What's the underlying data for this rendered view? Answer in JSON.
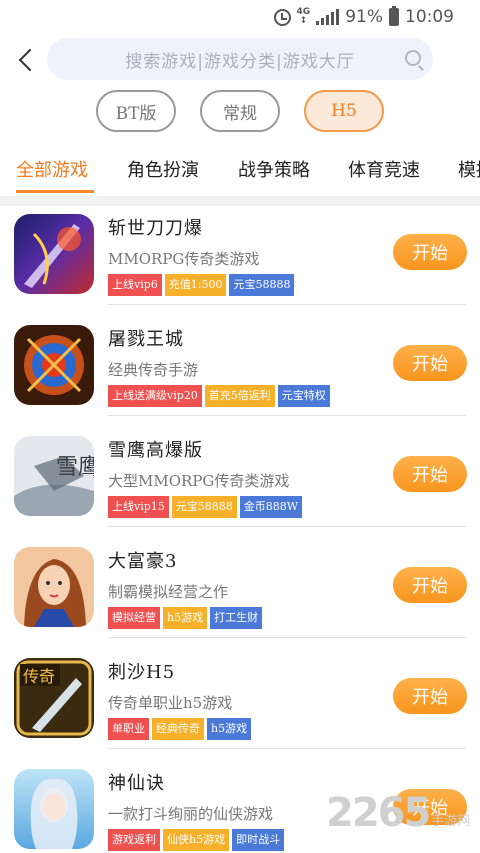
{
  "status_bar": {
    "network": "4G",
    "battery": "91%",
    "time": "10:09"
  },
  "header": {
    "search_placeholder": "搜索游戏|游戏分类|游戏大厅"
  },
  "versions": [
    {
      "label": "BT版",
      "active": false
    },
    {
      "label": "常规",
      "active": false
    },
    {
      "label": "H5",
      "active": true
    }
  ],
  "tabs": [
    {
      "label": "全部游戏",
      "active": true
    },
    {
      "label": "角色扮演",
      "active": false
    },
    {
      "label": "战争策略",
      "active": false
    },
    {
      "label": "体育竞速",
      "active": false
    },
    {
      "label": "模拟",
      "active": false
    }
  ],
  "games": [
    {
      "name": "斩世刀刀爆",
      "desc": "MMORPG传奇类游戏",
      "tags": [
        {
          "text": "上线vip6",
          "color": "red"
        },
        {
          "text": "充值1:500",
          "color": "orange"
        },
        {
          "text": "元宝58888",
          "color": "blue"
        }
      ],
      "button": "开始",
      "icon": "game-icon-zhanshi"
    },
    {
      "name": "屠戮王城",
      "desc": "经典传奇手游",
      "tags": [
        {
          "text": "上线送满级vip20",
          "color": "red"
        },
        {
          "text": "首充5倍返利",
          "color": "orange"
        },
        {
          "text": "元宝特权",
          "color": "blue"
        }
      ],
      "button": "开始",
      "icon": "game-icon-tulu"
    },
    {
      "name": "雪鹰高爆版",
      "desc": "大型MMORPG传奇类游戏",
      "tags": [
        {
          "text": "上线vip15",
          "color": "red"
        },
        {
          "text": "元宝58888",
          "color": "orange"
        },
        {
          "text": "金币888W",
          "color": "blue"
        }
      ],
      "button": "开始",
      "icon": "game-icon-xueying"
    },
    {
      "name": "大富豪3",
      "desc": "制霸模拟经营之作",
      "tags": [
        {
          "text": "模拟经营",
          "color": "red"
        },
        {
          "text": "h5游戏",
          "color": "orange"
        },
        {
          "text": "打工生财",
          "color": "blue"
        }
      ],
      "button": "开始",
      "icon": "game-icon-dafuhao"
    },
    {
      "name": "刺沙H5",
      "desc": "传奇单职业h5游戏",
      "tags": [
        {
          "text": "单职业",
          "color": "red"
        },
        {
          "text": "经典传奇",
          "color": "orange"
        },
        {
          "text": "h5游戏",
          "color": "blue"
        }
      ],
      "button": "开始",
      "icon": "game-icon-cisha"
    },
    {
      "name": "神仙诀",
      "desc": "一款打斗绚丽的仙侠游戏",
      "tags": [
        {
          "text": "游戏返利",
          "color": "red"
        },
        {
          "text": "仙侠h5游戏",
          "color": "orange"
        },
        {
          "text": "即时战斗",
          "color": "blue"
        }
      ],
      "button": "开始",
      "icon": "game-icon-shenxian"
    }
  ],
  "icon_texts": {
    "xueying": "雪鹰",
    "cisha": "传奇"
  },
  "watermark": {
    "number": "2265",
    "sub": "手游网"
  },
  "colors": {
    "accent": "#f27c20",
    "tag_red": "#ef5050",
    "tag_orange": "#f7b02a",
    "tag_blue": "#4a79d8"
  }
}
